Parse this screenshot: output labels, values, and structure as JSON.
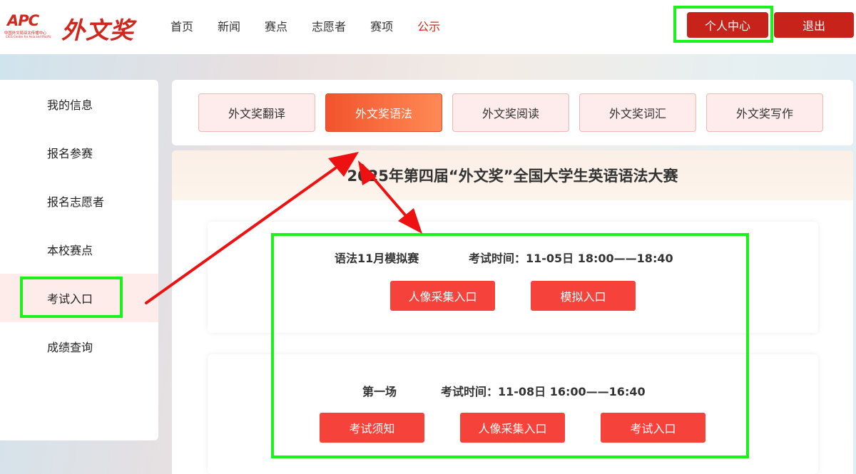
{
  "logo": {
    "apc": "APC",
    "apc_sub_cn": "中国外文局亚太传播中心",
    "apc_sub_en": "CICG Center for Asia and Pacific",
    "brand": "外文奖"
  },
  "nav": [
    "首页",
    "新闻",
    "赛点",
    "志愿者",
    "赛项",
    "公示"
  ],
  "header": {
    "personal_center": "个人中心",
    "logout": "退出"
  },
  "sidebar": [
    "我的信息",
    "报名参赛",
    "报名志愿者",
    "本校赛点",
    "考试入口",
    "成绩查询"
  ],
  "tabs": [
    "外文奖翻译",
    "外文奖语法",
    "外文奖阅读",
    "外文奖词汇",
    "外文奖写作"
  ],
  "main": {
    "title": "2025年第四届“外文奖”全国大学生英语语法大赛",
    "exams": [
      {
        "name": "语法11月模拟赛",
        "time": "考试时间：11-05日 18:00——18:40",
        "buttons": [
          "人像采集入口",
          "模拟入口"
        ]
      },
      {
        "name": "第一场",
        "time": "考试时间：11-08日 16:00——16:40",
        "buttons": [
          "考试须知",
          "人像采集入口",
          "考试入口"
        ]
      }
    ]
  },
  "colors": {
    "brand_red": "#c7231b",
    "highlight_green": "#1bf21b",
    "arrow_red": "#ee1111"
  }
}
